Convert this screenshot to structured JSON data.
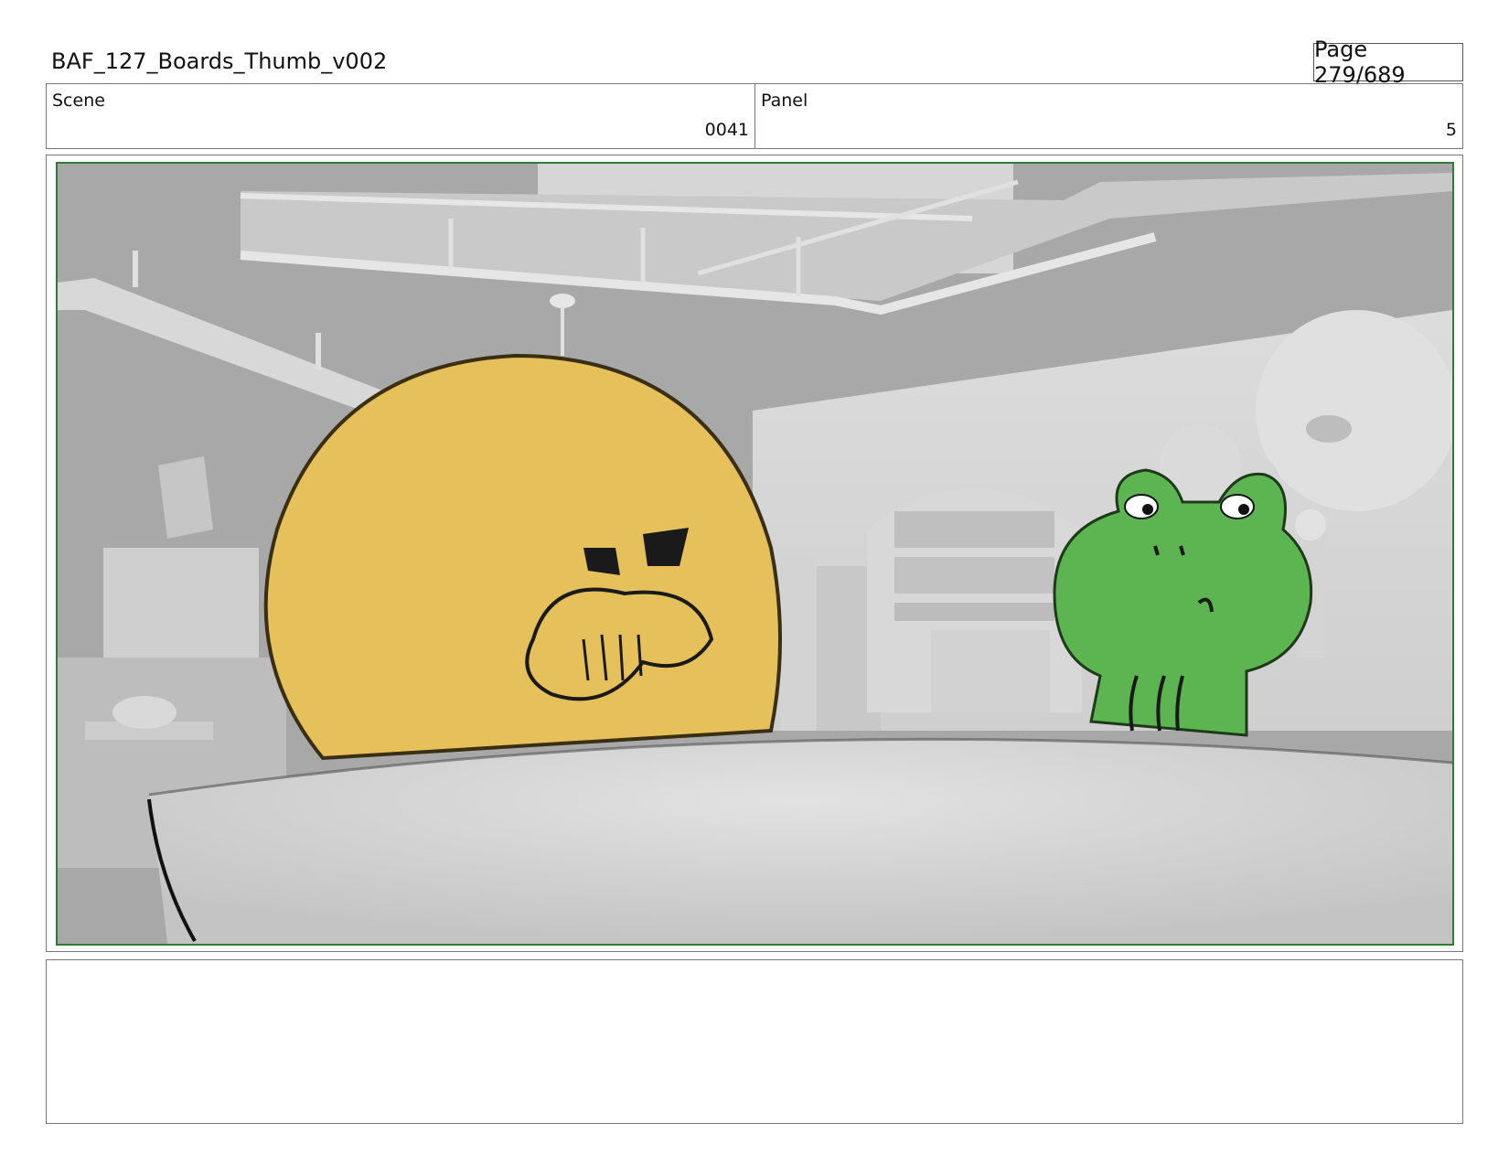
{
  "header": {
    "title": "BAF_127_Boards_Thumb_v002",
    "page_label": "Page 279/689"
  },
  "info": {
    "scene_label": "Scene",
    "scene_value": "0041",
    "panel_label": "Panel",
    "panel_value": "5"
  },
  "panel_image": {
    "description_icon": "storyboard-frame",
    "characters": [
      "yellow-blob-character",
      "green-frog-character"
    ],
    "frame_color": "#2e7d32",
    "yellow_color": "#e6c05a",
    "green_color": "#5cb551"
  },
  "notes": {
    "text": ""
  }
}
